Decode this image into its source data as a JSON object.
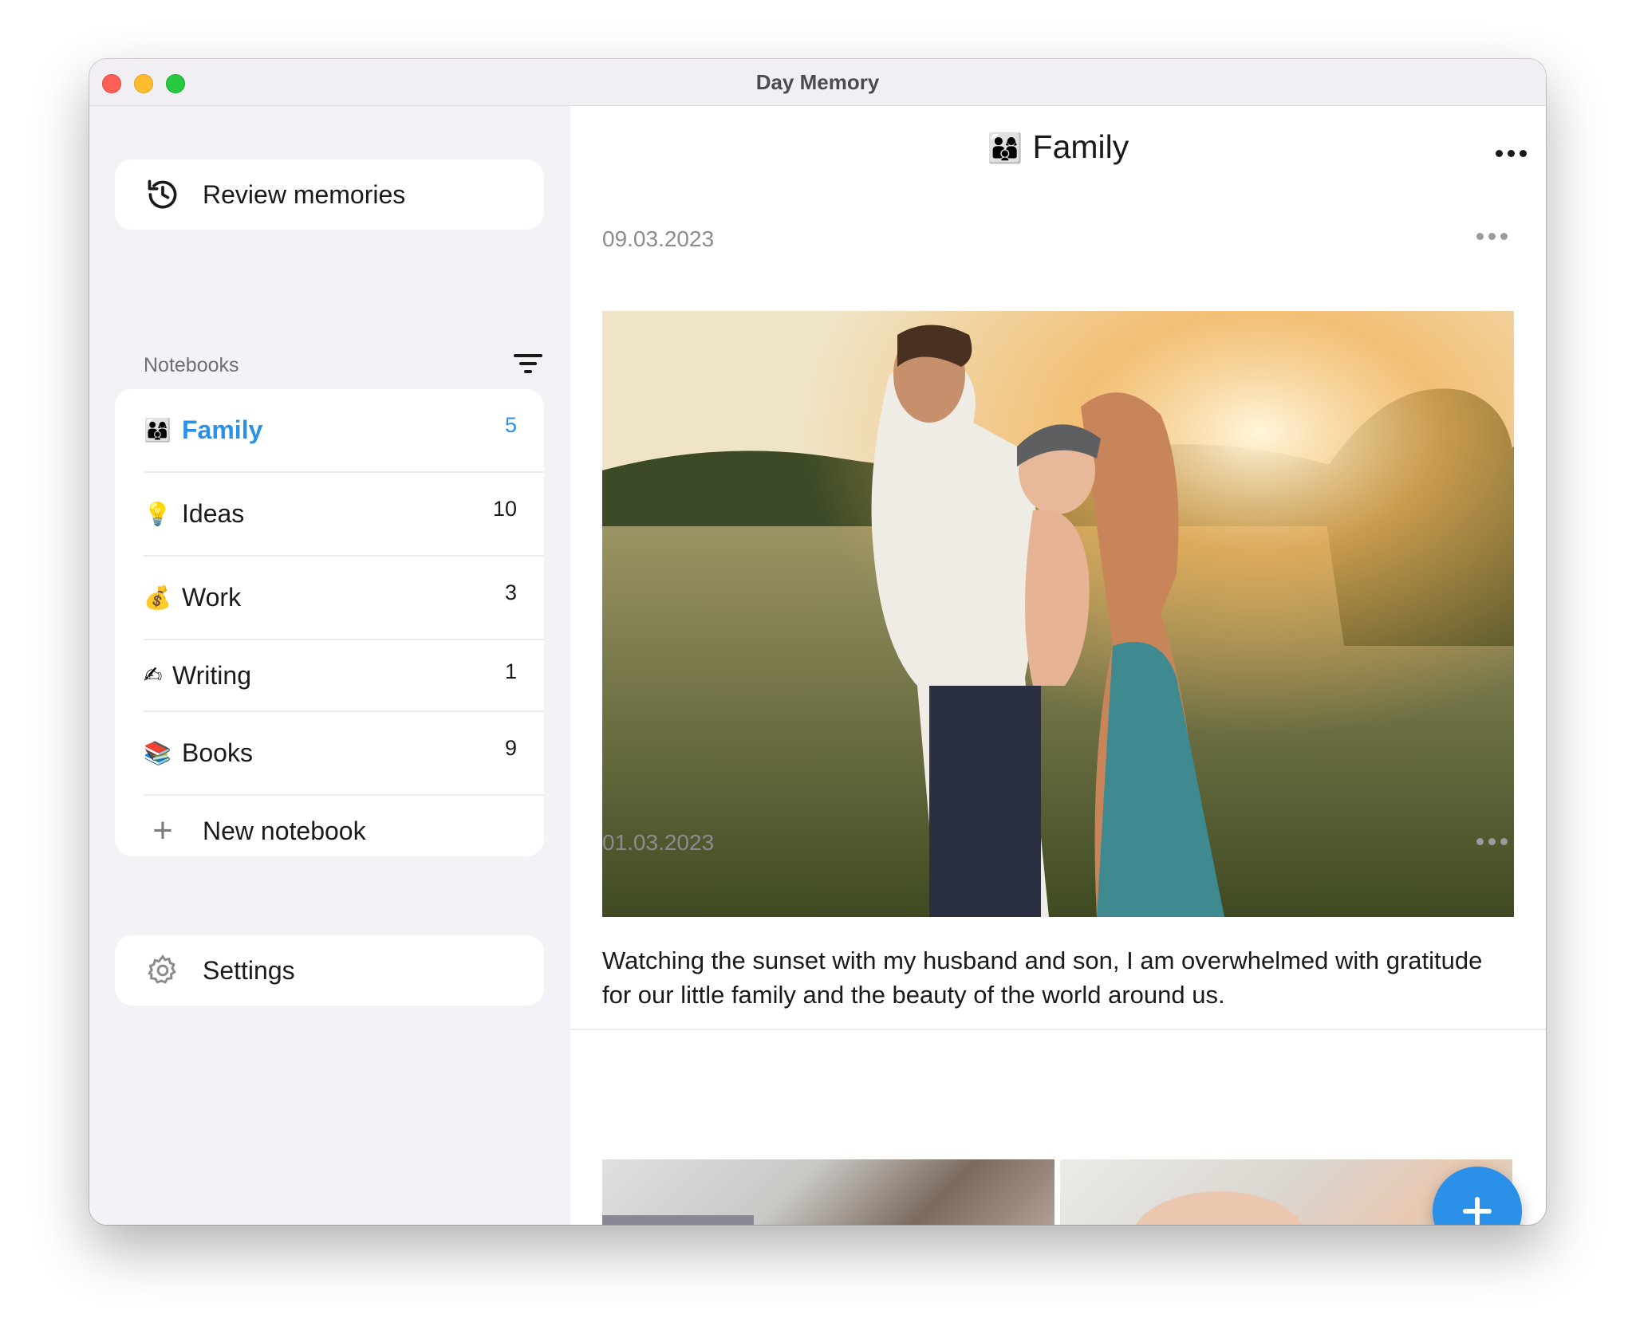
{
  "window": {
    "title": "Day Memory"
  },
  "sidebar": {
    "review_label": "Review memories",
    "notebooks_header": "Notebooks",
    "notebooks": [
      {
        "emoji": "👨‍👩‍👦",
        "name": "Family",
        "count": "5",
        "active": true
      },
      {
        "emoji": "💡",
        "name": "Ideas",
        "count": "10"
      },
      {
        "emoji": "💰",
        "name": "Work",
        "count": "3"
      },
      {
        "emoji": "✍",
        "name": "Writing",
        "count": "1"
      },
      {
        "emoji": "📚",
        "name": "Books",
        "count": "9"
      }
    ],
    "new_notebook_label": "New notebook",
    "settings_label": "Settings"
  },
  "main": {
    "emoji": "👨‍👩‍👦",
    "title": "Family",
    "entries": [
      {
        "date": "09.03.2023",
        "text": "Watching the sunset with my husband and son, I am overwhelmed with gratitude for our little family and the beauty of the world around us."
      },
      {
        "date": "01.03.2023"
      }
    ]
  },
  "colors": {
    "accent": "#2b90e8",
    "sidebar_bg": "#f3f2f7"
  }
}
